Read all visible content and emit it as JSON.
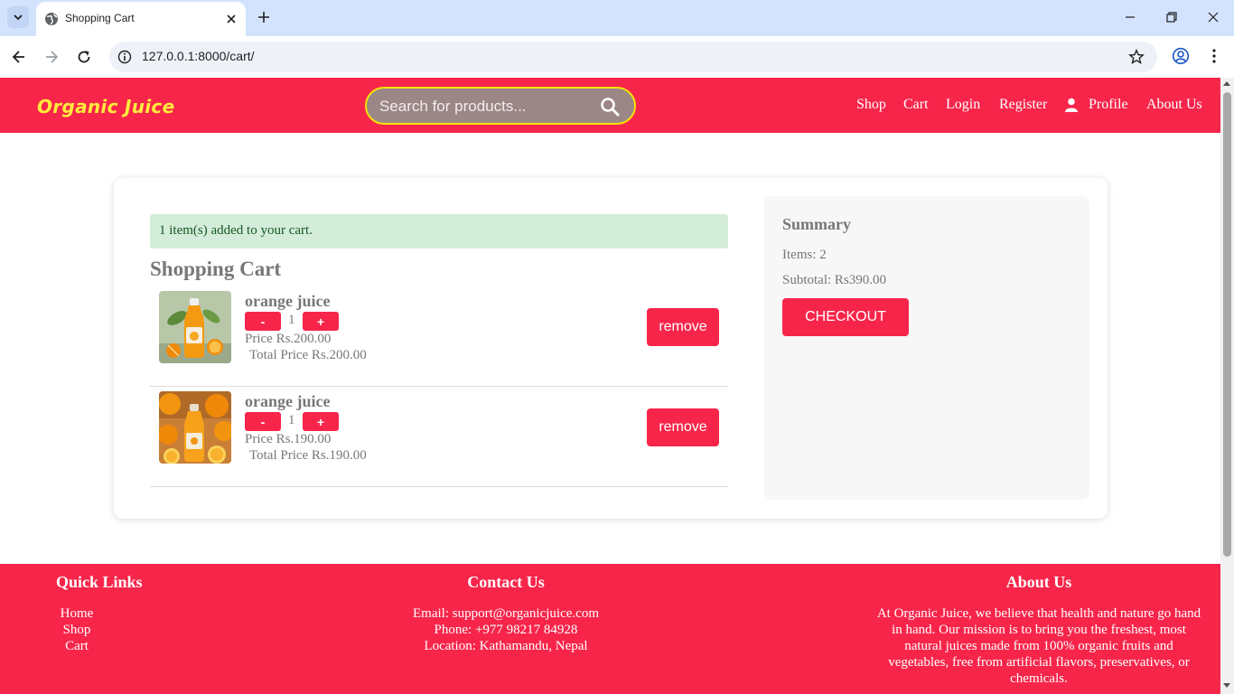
{
  "browser": {
    "tab_title": "Shopping Cart",
    "url": "127.0.0.1:8000/cart/"
  },
  "header": {
    "logo": "Organic Juice",
    "search_placeholder": "Search for products...",
    "nav": {
      "shop": "Shop",
      "cart": "Cart",
      "login": "Login",
      "register": "Register",
      "profile": "Profile",
      "about": "About Us"
    }
  },
  "cart": {
    "alert": "1 item(s) added to your cart.",
    "title": "Shopping Cart",
    "items": [
      {
        "name": "orange juice",
        "minus": "-",
        "quantity": "1",
        "plus": "+",
        "price": "Price Rs.200.00",
        "total": "Total Price Rs.200.00",
        "remove": "remove"
      },
      {
        "name": "orange juice",
        "minus": "-",
        "quantity": "1",
        "plus": "+",
        "price": "Price Rs.190.00",
        "total": "Total Price Rs.190.00",
        "remove": "remove"
      }
    ]
  },
  "summary": {
    "title": "Summary",
    "items": "Items: 2",
    "subtotal": "Subtotal: Rs390.00",
    "checkout": "CHECKOUT"
  },
  "footer": {
    "quick_links_title": "Quick Links",
    "links": [
      "Home",
      "Shop",
      "Cart"
    ],
    "contact_title": "Contact Us",
    "email": "Email: support@organicjuice.com",
    "phone": "Phone: +977 98217 84928",
    "location": "Location: Kathamandu, Nepal",
    "about_title": "About Us",
    "about_text": "At Organic Juice, we believe that health and nature go hand in hand. Our mission is to bring you the freshest, most natural juices made from 100% organic fruits and vegetables, free from artificial flavors, preservatives, or chemicals."
  },
  "colors": {
    "brand": "#f7254a",
    "logo": "#ffeb3b",
    "alert_bg": "#d4edda",
    "alert_text": "#155724"
  }
}
